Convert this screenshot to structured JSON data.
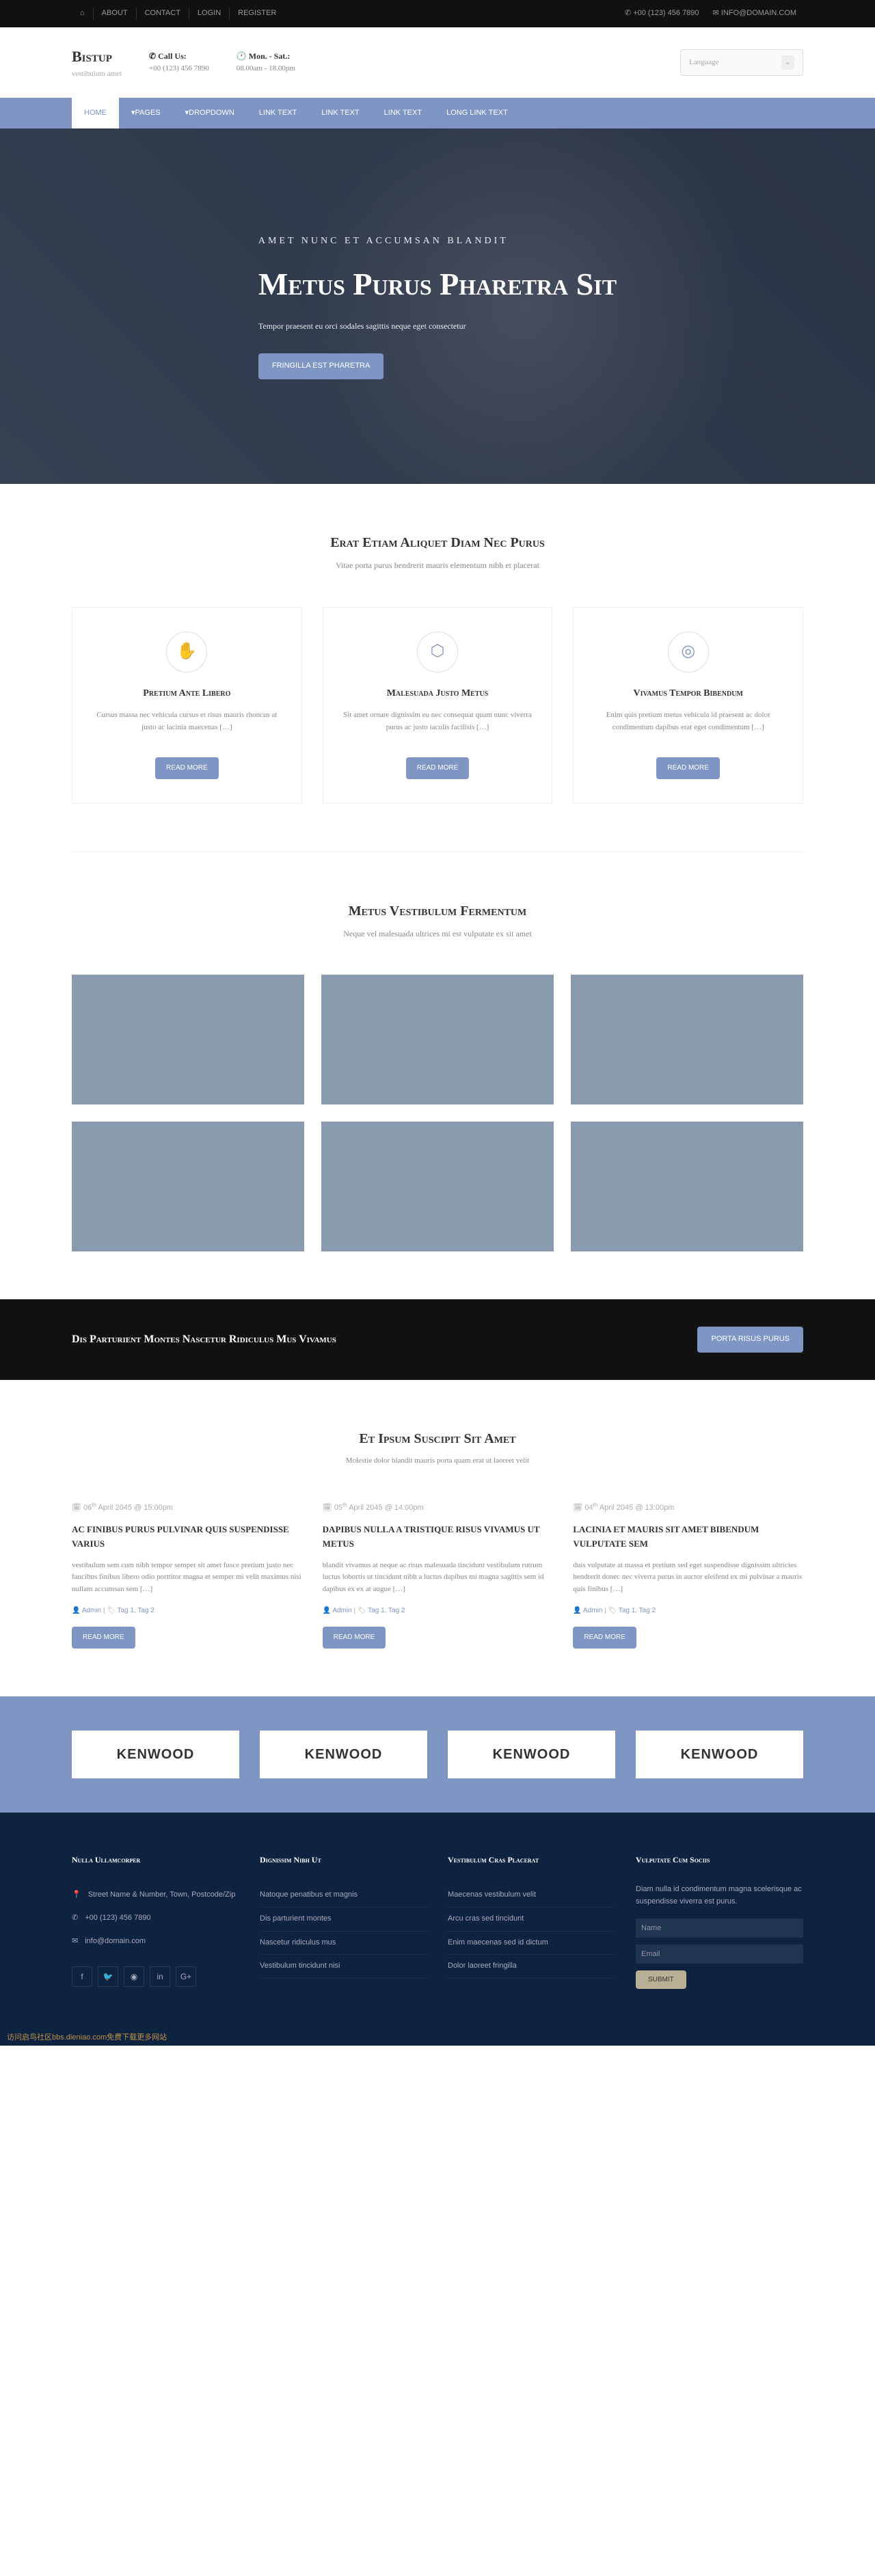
{
  "topbar": {
    "left": [
      "ABOUT",
      "CONTACT",
      "LOGIN",
      "REGISTER"
    ],
    "phone": "+00 (123) 456 7890",
    "email": "INFO@DOMAIN.COM"
  },
  "header": {
    "logo": "Bistup",
    "tagline": "vestibulum amet",
    "call_label": "Call Us:",
    "call_value": "+00 (123) 456 7890",
    "hours_label": "Mon. - Sat.:",
    "hours_value": "08.00am - 18.00pm",
    "lang": "Language"
  },
  "nav": [
    "HOME",
    "PAGES",
    "DROPDOWN",
    "LINK TEXT",
    "LINK TEXT",
    "LINK TEXT",
    "LONG LINK TEXT"
  ],
  "hero": {
    "sub": "AMET NUNC ET ACCUMSAN BLANDIT",
    "title": "Metus Purus Pharetra Sit",
    "text": "Tempor praesent eu orci sodales sagittis neque eget consectetur",
    "btn": "FRINGILLA EST PHARETRA"
  },
  "intro": {
    "title": "Erat Etiam Aliquet Diam Nec Purus",
    "sub": "Vitae porta purus hendrerit mauris elementum nibh et placerat",
    "cards": [
      {
        "icon": "✋",
        "title": "Pretium Ante Libero",
        "text": "Cursus massa nec vehicula cursus et risus mauris rhoncus at justo ac lacinia maecenas […]",
        "btn": "READ MORE"
      },
      {
        "icon": "⬡",
        "title": "Malesuada Justo Metus",
        "text": "Sit amet ornare dignissim eu nec consequat quam nunc viverra purus ac justo iaculis facilisis […]",
        "btn": "READ MORE"
      },
      {
        "icon": "◎",
        "title": "Vivamus Tempor Bibendum",
        "text": "Enim quis pretium metus vehicula id praesent ac dolor condimentum dapibus erat eget condimentum […]",
        "btn": "READ MORE"
      }
    ]
  },
  "gallery": {
    "title": "Metus Vestibulum Fermentum",
    "sub": "Neque vel malesuada ultrices mi est vulputate ex sit amet"
  },
  "cta": {
    "title": "Dis Parturient Montes Nascetur Ridiculus Mus Vivamus",
    "btn": "PORTA RISUS PURUS"
  },
  "blog": {
    "title": "Et Ipsum Suscipit Sit Amet",
    "sub": "Molestie dolor blandit mauris porta quam erat ut laoreet velit",
    "posts": [
      {
        "date_d": "06",
        "date_rest": " April 2045 @ 15:00pm",
        "title": "Ac Finibus Purus Pulvinar Quis Suspendisse Varius",
        "text": "vestibulum sem cum nibh tempor semper sit amet fusce pretium justo nec faucibus finibus libero odio porttitor magna et semper mi velit maximus nisi nullam accumsan sem […]",
        "admin": "Admin",
        "tags": "Tag 1, Tag 2",
        "btn": "READ MORE"
      },
      {
        "date_d": "05",
        "date_rest": " April 2045 @ 14:00pm",
        "title": "Dapibus Nulla A Tristique Risus Vivamus Ut Metus",
        "text": "blandit vivamus at neque ac risus malesuada tincidunt vestibulum rutrum luctus lobortis ut tincidunt nibh a luctus dapibus mi magna sagittis sem id dapibus ex ex at augue […]",
        "admin": "Admin",
        "tags": "Tag 1, Tag 2",
        "btn": "READ MORE"
      },
      {
        "date_d": "04",
        "date_rest": " April 2045 @ 13:00pm",
        "title": "Lacinia Et Mauris Sit Amet Bibendum Vulputate Sem",
        "text": "duis vulputate at massa et pretium sed eget suspendisse dignissim ultricies hendrerit donec nec viverra purus in auctor eleifend ex mi pulvinar a mauris quis finibus […]",
        "admin": "Admin",
        "tags": "Tag 1, Tag 2",
        "btn": "READ MORE"
      }
    ]
  },
  "clients": [
    "KENWOOD",
    "KENWOOD",
    "KENWOOD",
    "KENWOOD"
  ],
  "footer": {
    "col1": {
      "title": "Nulla Ullamcorper",
      "addr": "Street Name & Number, Town, Postcode/Zip",
      "phone": "+00 (123) 456 7890",
      "email": "info@domain.com"
    },
    "col2": {
      "title": "Dignissim Nibh Ut",
      "links": [
        "Natoque penatibus et magnis",
        "Dis parturient montes",
        "Nascetur ridiculus mus",
        "Vestibulum tincidunt nisi"
      ]
    },
    "col3": {
      "title": "Vestibulum Cras Placerat",
      "links": [
        "Maecenas vestibulum velit",
        "Arcu cras sed tincidunt",
        "Enim maecenas sed id dictum",
        "Dolor laoreet fringilla"
      ]
    },
    "col4": {
      "title": "Vulputate Cum Sociis",
      "text": "Diam nulla id condimentum magna scelerisque ac suspendisse viverra est purus.",
      "name_ph": "Name",
      "email_ph": "Email",
      "btn": "SUBMIT"
    }
  },
  "watermark": "访问启鸟社区bbs.dieniao.com免费下载更多网站"
}
